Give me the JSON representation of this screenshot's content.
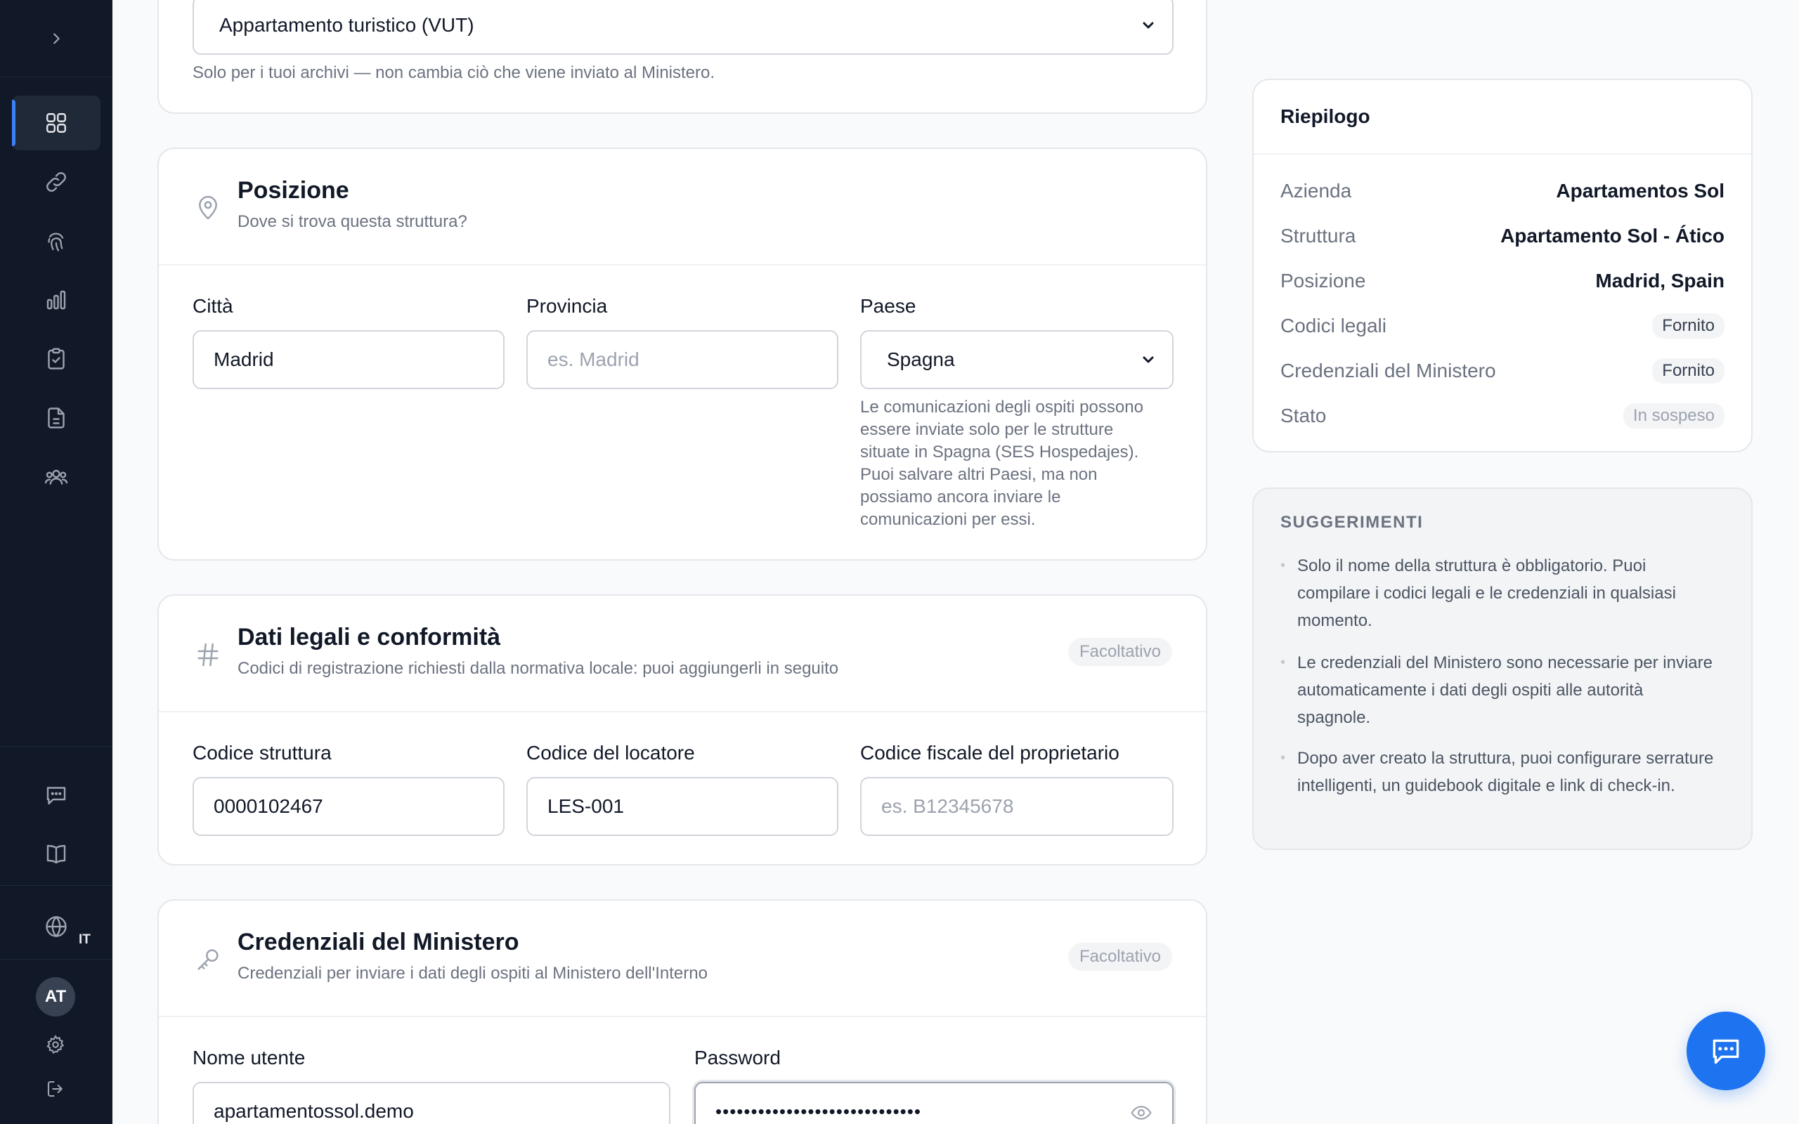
{
  "sidebar": {
    "lang_code": "IT",
    "avatar_initials": "AT"
  },
  "type_card": {
    "select_value": "Appartamento turistico (VUT)",
    "help": "Solo per i tuoi archivi — non cambia ciò che viene inviato al Ministero."
  },
  "position_card": {
    "title": "Posizione",
    "subtitle": "Dove si trova questa struttura?",
    "city_label": "Città",
    "city_value": "Madrid",
    "province_label": "Provincia",
    "province_placeholder": "es. Madrid",
    "country_label": "Paese",
    "country_value": "Spagna",
    "country_help": "Le comunicazioni degli ospiti possono essere inviate solo per le strutture situate in Spagna (SES Hospedajes). Puoi salvare altri Paesi, ma non possiamo ancora inviare le comunicazioni per essi."
  },
  "legal_card": {
    "title": "Dati legali e conformità",
    "subtitle": "Codici di registrazione richiesti dalla normativa locale: puoi aggiungerli in seguito",
    "badge": "Facoltativo",
    "code_label": "Codice struttura",
    "code_value": "0000102467",
    "landlord_label": "Codice del locatore",
    "landlord_value": "LES-001",
    "taxid_label": "Codice fiscale del proprietario",
    "taxid_placeholder": "es. B12345678"
  },
  "credentials_card": {
    "title": "Credenziali del Ministero",
    "subtitle": "Credenziali per inviare i dati degli ospiti al Ministero dell'Interno",
    "badge": "Facoltativo",
    "username_label": "Nome utente",
    "username_value": "apartamentossol.demo",
    "password_label": "Password",
    "password_mask": "•••••••••••••••••••••••••••••"
  },
  "summary": {
    "title": "Riepilogo",
    "rows": [
      {
        "key": "Azienda",
        "value": "Apartamentos Sol"
      },
      {
        "key": "Struttura",
        "value": "Apartamento Sol - Ático"
      },
      {
        "key": "Posizione",
        "value": "Madrid, Spain"
      },
      {
        "key": "Codici legali",
        "value": "Fornito"
      },
      {
        "key": "Credenziali del Ministero",
        "value": "Fornito"
      },
      {
        "key": "Stato",
        "value": "In sospeso"
      }
    ]
  },
  "tips": {
    "title": "SUGGERIMENTI",
    "items": [
      "Solo il nome della struttura è obbligatorio. Puoi compilare i codici legali e le credenziali in qualsiasi momento.",
      "Le credenziali del Ministero sono necessarie per inviare automaticamente i dati degli ospiti alle autorità spagnole.",
      "Dopo aver creato la struttura, puoi configurare serrature intelligenti, un guidebook digitale e link di check-in."
    ]
  },
  "icons": {
    "sidebar_nav": [
      "dashboard-icon",
      "link-icon",
      "fingerprint-icon",
      "bar-chart-icon",
      "clipboard-check-icon",
      "document-icon",
      "users-icon"
    ],
    "sidebar_bottom": [
      "chat-icon",
      "book-icon",
      "globe-icon",
      "gear-icon",
      "logout-icon"
    ]
  },
  "colors": {
    "sidebar_bg": "#111827",
    "accent": "#3b82f6",
    "fab": "#1d73f0"
  }
}
